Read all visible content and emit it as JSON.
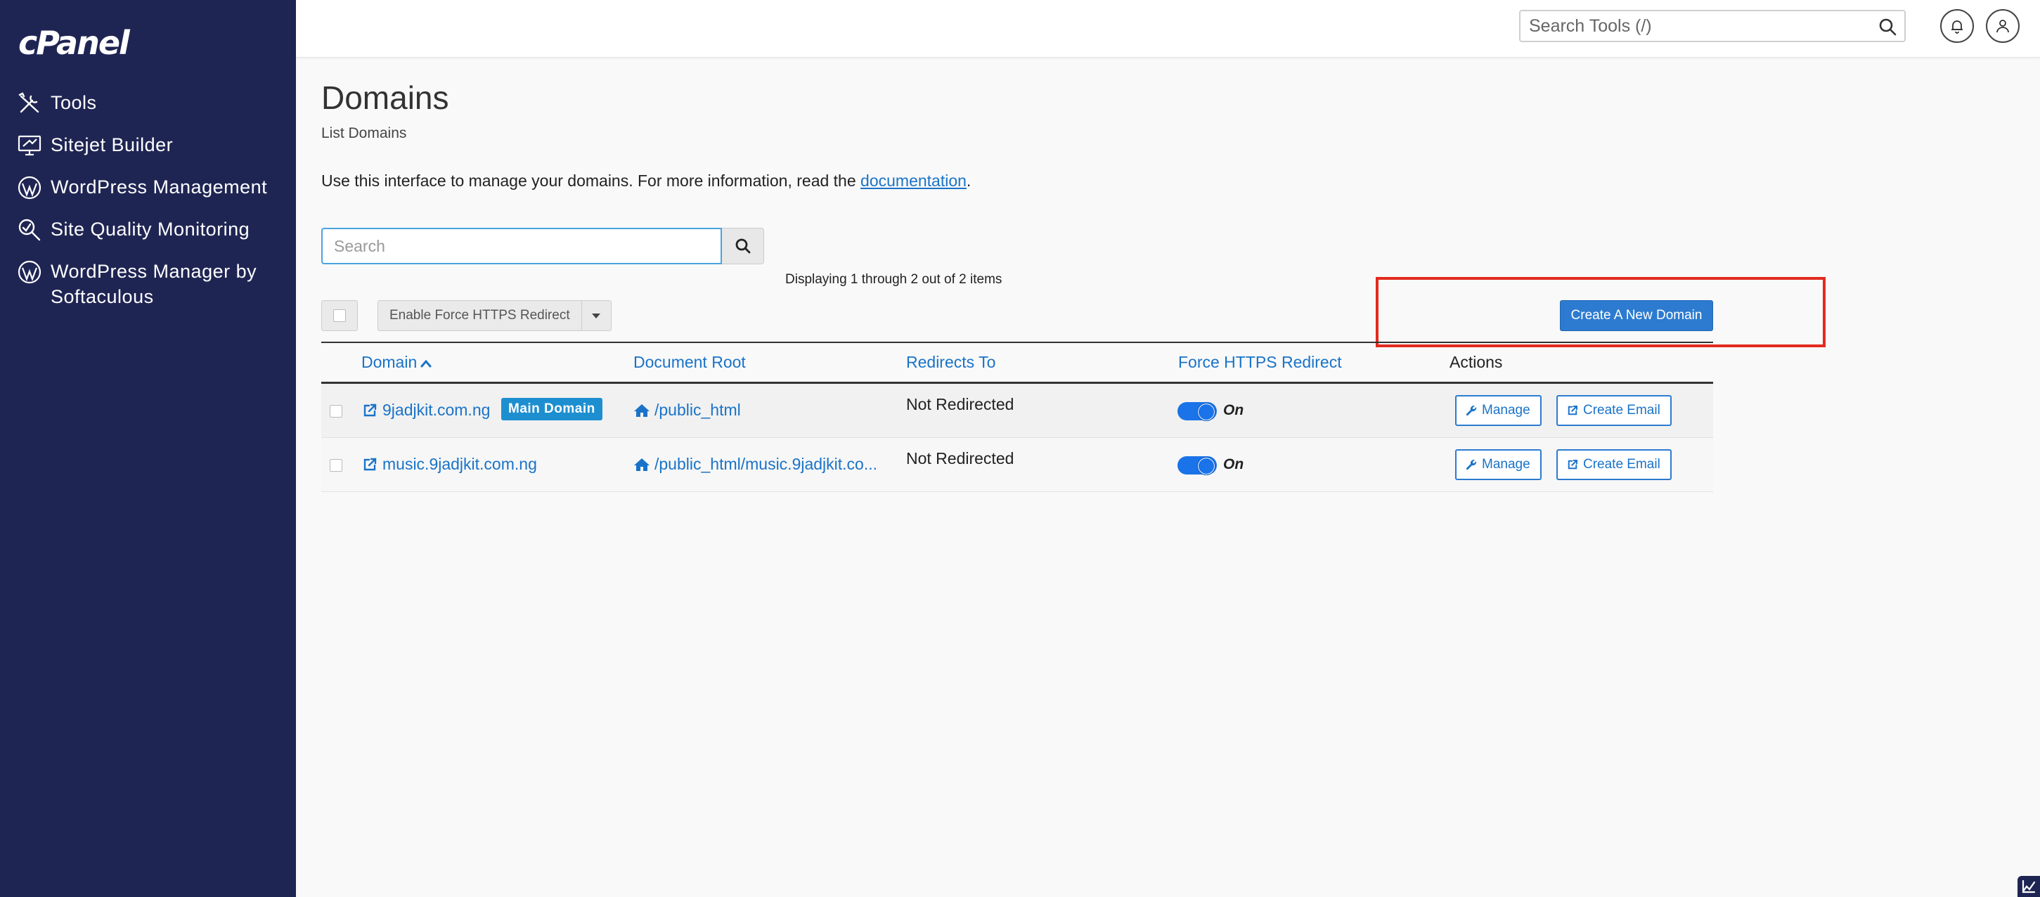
{
  "sidebar": {
    "logo": "cPanel",
    "items": [
      {
        "label": "Tools",
        "icon": "tools-icon"
      },
      {
        "label": "Sitejet Builder",
        "icon": "sitejet-icon"
      },
      {
        "label": "WordPress Management",
        "icon": "wordpress-icon"
      },
      {
        "label": "Site Quality Monitoring",
        "icon": "quality-monitor-icon"
      },
      {
        "label": "WordPress Manager by Softaculous",
        "icon": "wordpress-icon"
      }
    ]
  },
  "topbar": {
    "search_placeholder": "Search Tools (/)"
  },
  "page": {
    "title": "Domains",
    "subtitle": "List Domains",
    "intro_text": "Use this interface to manage your domains. For more information, read the ",
    "intro_link": "documentation",
    "intro_end": ".",
    "search_placeholder": "Search",
    "displaying": "Displaying 1 through 2 out of 2 items",
    "bulk_action": "Enable Force HTTPS Redirect",
    "create_button": "Create A New Domain"
  },
  "table": {
    "headers": {
      "domain": "Domain",
      "document_root": "Document Root",
      "redirects_to": "Redirects To",
      "force_https": "Force HTTPS Redirect",
      "actions": "Actions"
    },
    "rows": [
      {
        "domain": "9jadjkit.com.ng",
        "badge": "Main Domain",
        "document_root": "/public_html",
        "redirects_to": "Not Redirected",
        "https_state": "On",
        "manage": "Manage",
        "create_email": "Create Email"
      },
      {
        "domain": "music.9jadjkit.com.ng",
        "badge": "",
        "document_root": "/public_html/music.9jadjkit.co...",
        "redirects_to": "Not Redirected",
        "https_state": "On",
        "manage": "Manage",
        "create_email": "Create Email"
      }
    ]
  },
  "colors": {
    "sidebar_bg": "#1f2553",
    "link": "#1a73c8",
    "primary_button": "#2c7bd0",
    "badge": "#1d8fd0",
    "highlight": "#e32a1f"
  }
}
